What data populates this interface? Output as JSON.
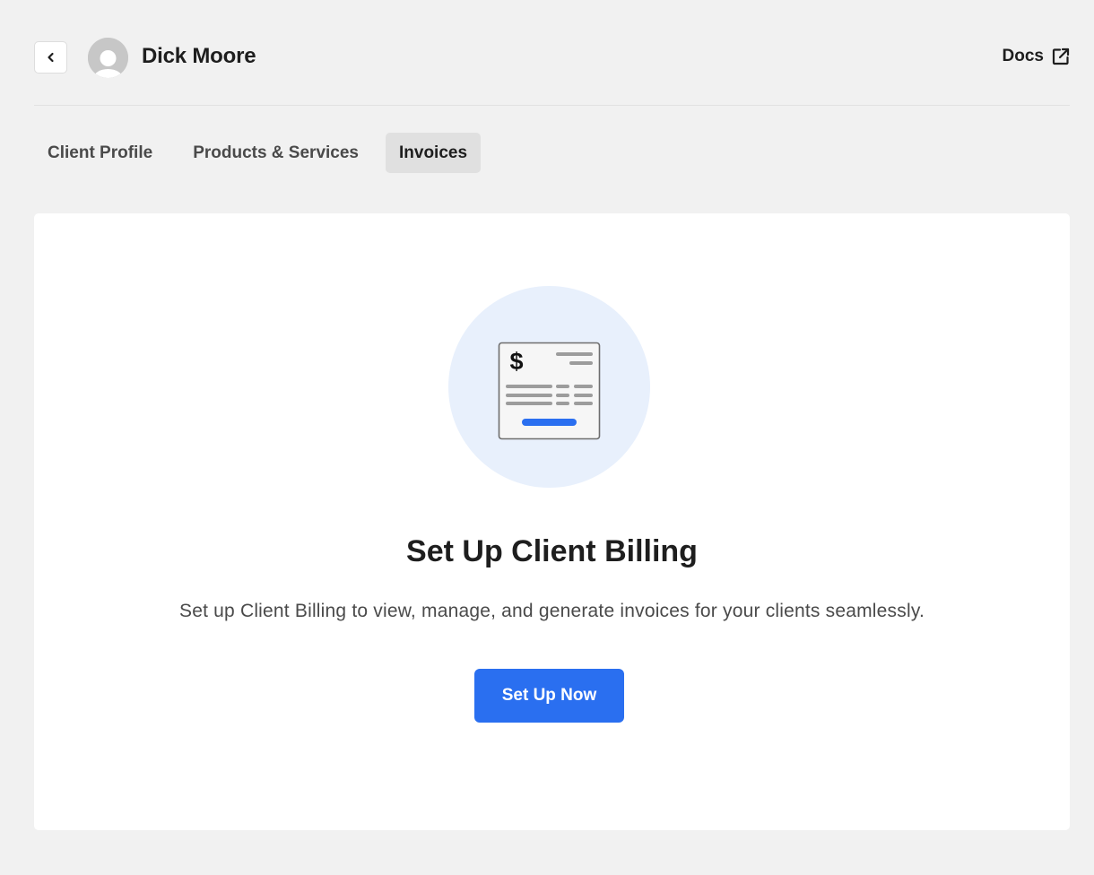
{
  "header": {
    "back_icon": "chevron-left-icon",
    "avatar_icon": "user-avatar-icon",
    "client_name": "Dick Moore",
    "docs_label": "Docs",
    "docs_icon": "external-link-icon"
  },
  "tabs": [
    {
      "label": "Client Profile",
      "active": false
    },
    {
      "label": "Products & Services",
      "active": false
    },
    {
      "label": "Invoices",
      "active": true
    }
  ],
  "empty_state": {
    "illustration_icon": "invoice-dollar-icon",
    "title": "Set Up Client Billing",
    "description": "Set up Client Billing to view, manage, and generate invoices for your clients seamlessly.",
    "cta_label": "Set Up Now"
  },
  "colors": {
    "page_background": "#f1f1f1",
    "accent": "#2a6ff0",
    "illustration_background": "#e8f0fc",
    "active_tab_background": "#e0e0e0"
  }
}
